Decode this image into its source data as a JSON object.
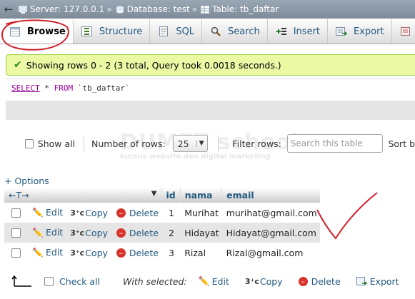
{
  "breadcrumb": {
    "server": "Server: 127.0.0.1",
    "database": "Database: test",
    "table": "Table: tb_daftar",
    "separator": "»"
  },
  "tabs": [
    {
      "label": "Browse",
      "icon": "browse-icon",
      "active": true
    },
    {
      "label": "Structure",
      "icon": "structure-icon"
    },
    {
      "label": "SQL",
      "icon": "sql-icon"
    },
    {
      "label": "Search",
      "icon": "search-icon"
    },
    {
      "label": "Insert",
      "icon": "insert-icon"
    },
    {
      "label": "Export",
      "icon": "export-icon"
    }
  ],
  "message": "Showing rows 0 - 2 (3 total, Query took 0.0018 seconds.)",
  "query": {
    "select": "SELECT",
    "star": " * ",
    "from": "FROM",
    "table": "`tb_daftar`"
  },
  "controls": {
    "show_all": "Show all",
    "number_of_rows_label": "Number of rows:",
    "rows_value": "25",
    "filter_label": "Filter rows:",
    "filter_placeholder": "Search this table",
    "sort_label": "Sort b"
  },
  "watermark": {
    "title": "DUMET school",
    "subtitle": "kursus website dan digital marketing"
  },
  "options_link": "+ Options",
  "table": {
    "columns": [
      "id",
      "nama",
      "email"
    ],
    "actions": {
      "edit": "Edit",
      "copy": "Copy",
      "delete": "Delete"
    },
    "rows": [
      {
        "id": "1",
        "nama": "Murihat",
        "email": "murihat@gmail.com"
      },
      {
        "id": "2",
        "nama": "Hidayat",
        "email": "Hidayat@gmail.com"
      },
      {
        "id": "3",
        "nama": "Rizal",
        "email": "Rizal@gmail.com"
      }
    ]
  },
  "bottom": {
    "check_all": "Check all",
    "with_selected": "With selected:",
    "edit": "Edit",
    "copy": "Copy",
    "delete": "Delete",
    "export": "Export"
  },
  "colors": {
    "link": "#235a81",
    "success_bg": "#ebf8a4",
    "annotation": "#d0202a"
  }
}
